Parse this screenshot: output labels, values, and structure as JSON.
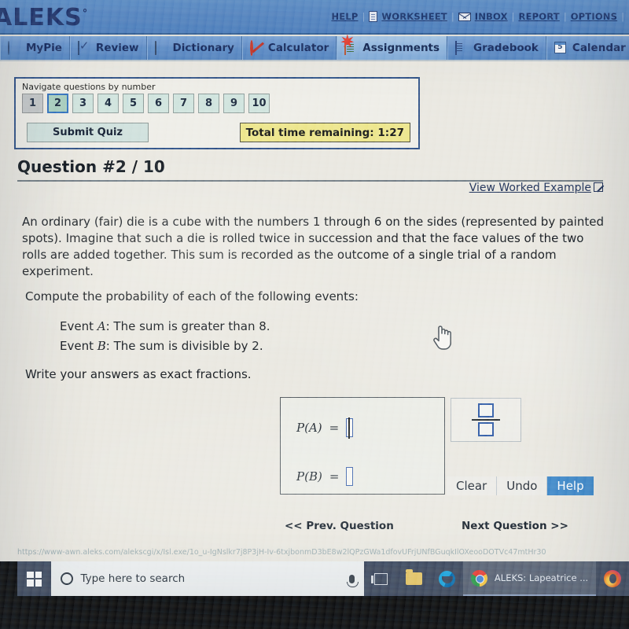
{
  "header": {
    "logo": "ALEKS",
    "logo_mark": "°",
    "links": [
      {
        "label": "HELP",
        "icon": ""
      },
      {
        "label": "WORKSHEET",
        "icon": "document-icon"
      },
      {
        "label": "INBOX",
        "icon": "envelope-icon"
      },
      {
        "label": "REPORT",
        "icon": ""
      },
      {
        "label": "OPTIONS",
        "icon": ""
      }
    ]
  },
  "tabs": [
    {
      "label": "MyPie",
      "icon": "pie-icon",
      "active": false
    },
    {
      "label": "Review",
      "icon": "checkmark-icon",
      "active": false
    },
    {
      "label": "Dictionary",
      "icon": "book-icon",
      "active": false
    },
    {
      "label": "Calculator",
      "icon": "calculator-disabled-icon",
      "active": false
    },
    {
      "label": "Assignments",
      "icon": "assignment-icon",
      "active": true
    },
    {
      "label": "Gradebook",
      "icon": "gradebook-icon",
      "active": false
    },
    {
      "label": "Calendar",
      "icon": "calendar-icon",
      "active": false
    }
  ],
  "nav_panel": {
    "label": "Navigate questions by number",
    "numbers": [
      "1",
      "2",
      "3",
      "4",
      "5",
      "6",
      "7",
      "8",
      "9",
      "10"
    ],
    "current_index": 1,
    "visited_index": 0,
    "submit_label": "Submit Quiz",
    "timer_label": "Total time remaining: 1:27",
    "timer_value": "1:27"
  },
  "question": {
    "title": "Question #2 / 10",
    "worked_example_label": "View Worked Example",
    "body": "An ordinary (fair) die is a cube with the numbers 1 through 6 on the sides (represented by painted spots). Imagine that such a die is rolled twice in succession and that the face values of the two rolls are added together. This sum is recorded as the outcome of a single trial of a random experiment.",
    "prompt": "Compute the probability of each of the following events:",
    "events": [
      {
        "prefix": "Event ",
        "name": "A",
        "text": ": The sum is greater than 8."
      },
      {
        "prefix": "Event ",
        "name": "B",
        "text": ": The sum is divisible by 2."
      }
    ],
    "note": "Write your answers as exact fractions."
  },
  "answer_box": {
    "rows": [
      {
        "left": "P",
        "arg": "A",
        "equals": "=",
        "value": "",
        "focused": true
      },
      {
        "left": "P",
        "arg": "B",
        "equals": "=",
        "value": "",
        "focused": false
      }
    ]
  },
  "palette": {
    "fraction_tool": "fraction-template-icon"
  },
  "tools": [
    {
      "label": "Clear",
      "style": "default"
    },
    {
      "label": "Undo",
      "style": "default"
    },
    {
      "label": "Help",
      "style": "primary"
    }
  ],
  "pagination": {
    "prev": "<< Prev. Question",
    "next": "Next Question >>"
  },
  "status_bar": {
    "url": "https://www-awn.aleks.com/alekscgi/x/Isl.exe/1o_u-IgNslkr7j8P3jH-Iv-6txjbonmD3bE8w2lQPzGWa1dfovUFrjUNfBGuqkIlOXeooDOTVc47mtHr30"
  },
  "taskbar": {
    "start": "windows-start-icon",
    "search_placeholder": "Type here to search",
    "mic": "microphone-icon",
    "icons": [
      "task-view-icon",
      "file-explorer-icon",
      "edge-icon"
    ],
    "window_button": {
      "title": "ALEKS: Lapeatrice ...",
      "icon": "chrome-icon"
    },
    "tray_icon": "firefox-icon"
  },
  "colors": {
    "header_blue": "#5588c8",
    "logo_navy": "#1b2f6b",
    "tab_active": "#8fb6e0",
    "timer_yellow": "#ece58a",
    "current_question": "#a9cfbf",
    "current_question_border": "#2f6fbe",
    "help_blue": "#3d87c9",
    "input_border": "#3a5ea8",
    "taskbar": "#3f4a60"
  }
}
